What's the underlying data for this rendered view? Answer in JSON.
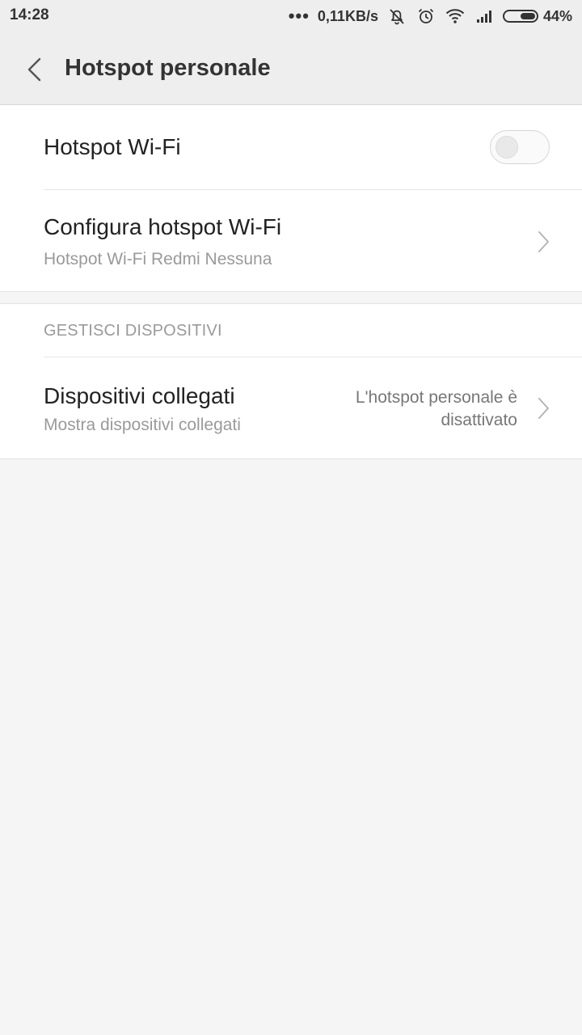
{
  "status_bar": {
    "time": "14:28",
    "dots": "•••",
    "network_speed": "0,11KB/s",
    "battery_percent": "44%",
    "icons": [
      "notifications-off-icon",
      "alarm-icon",
      "wifi-icon",
      "signal-icon",
      "battery-icon"
    ]
  },
  "header": {
    "title": "Hotspot personale",
    "back_icon": "back-chevron-icon"
  },
  "settings": {
    "hotspot_toggle": {
      "label": "Hotspot Wi-Fi",
      "enabled": false
    },
    "configure": {
      "label": "Configura hotspot Wi-Fi",
      "subtitle": "Hotspot Wi-Fi Redmi Nessuna"
    }
  },
  "devices_section": {
    "header": "GESTISCI DISPOSITIVI",
    "connected": {
      "label": "Dispositivi collegati",
      "subtitle": "Mostra dispositivi collegati",
      "status_line1": "L'hotspot personale è",
      "status_line2": "disattivato"
    }
  },
  "colors": {
    "background": "#f5f5f5",
    "card": "#ffffff",
    "header": "#eeeeee",
    "secondary_text": "#9a9a9a"
  }
}
